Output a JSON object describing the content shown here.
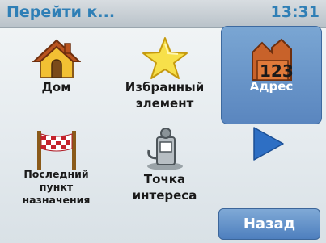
{
  "header": {
    "title": "Перейти к...",
    "time": "13:31"
  },
  "tiles": [
    {
      "label": "Дом",
      "icon": "house-icon"
    },
    {
      "label": "Избранный элемент",
      "icon": "star-icon"
    },
    {
      "label": "Адрес",
      "icon": "address-icon",
      "icon_text": "123"
    },
    {
      "label": "Последний пункт назначения",
      "icon": "finish-flag-icon"
    },
    {
      "label": "Точка интереса",
      "icon": "point-of-interest-icon"
    }
  ],
  "nav": {
    "next_icon": "next-arrow-icon"
  },
  "footer": {
    "back_label": "Назад"
  },
  "colors": {
    "title": "#2f7fb6",
    "selected_tile": "#5a86bf",
    "back_button": "#4e7fbe",
    "arrow": "#2e6fc4"
  }
}
